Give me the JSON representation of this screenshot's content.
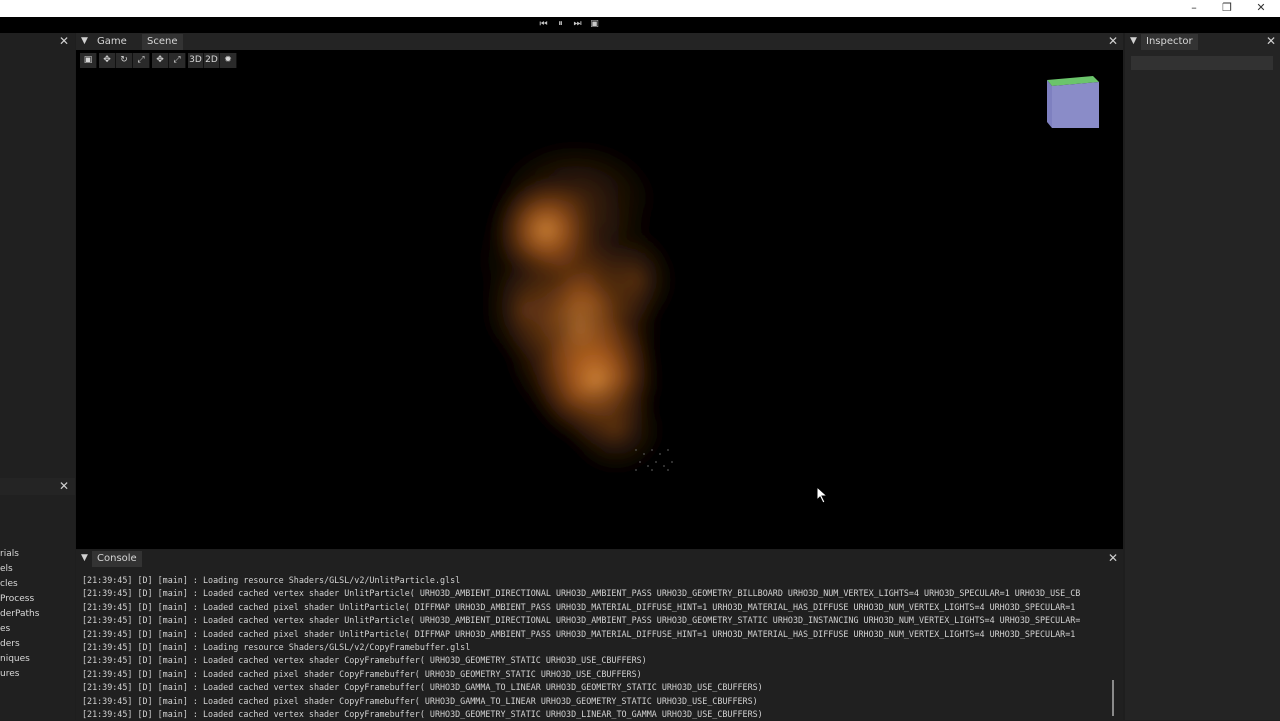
{
  "window": {
    "minimize_icon": "minimize-icon",
    "restore_icon": "restore-icon",
    "close_icon": "close-icon"
  },
  "transport": [
    "skip-back-icon",
    "pause-icon",
    "step-forward-icon",
    "save-icon"
  ],
  "hierarchy_panel": {
    "items": [
      "rials",
      "els",
      "cles",
      "Process",
      "derPaths",
      "es",
      "ders",
      "niques",
      "ures"
    ]
  },
  "viewport_panel": {
    "tabs": [
      {
        "label": "Game",
        "active": false
      },
      {
        "label": "Scene",
        "active": true
      }
    ],
    "toolbar": {
      "mode_3d": "3D",
      "mode_2d": "2D"
    }
  },
  "inspector_panel": {
    "title": "Inspector"
  },
  "console_panel": {
    "title": "Console",
    "lines": [
      "[21:39:45] [D] [main] : Loading resource Shaders/GLSL/v2/UnlitParticle.glsl",
      "[21:39:45] [D] [main] : Loaded cached vertex shader UnlitParticle( URHO3D_AMBIENT_DIRECTIONAL URHO3D_AMBIENT_PASS URHO3D_GEOMETRY_BILLBOARD URHO3D_NUM_VERTEX_LIGHTS=4 URHO3D_SPECULAR=1 URHO3D_USE_CB",
      "[21:39:45] [D] [main] : Loaded cached pixel shader UnlitParticle( DIFFMAP URHO3D_AMBIENT_PASS URHO3D_MATERIAL_DIFFUSE_HINT=1 URHO3D_MATERIAL_HAS_DIFFUSE URHO3D_NUM_VERTEX_LIGHTS=4 URHO3D_SPECULAR=1",
      "[21:39:45] [D] [main] : Loaded cached vertex shader UnlitParticle( URHO3D_AMBIENT_DIRECTIONAL URHO3D_AMBIENT_PASS URHO3D_GEOMETRY_STATIC URHO3D_INSTANCING URHO3D_NUM_VERTEX_LIGHTS=4 URHO3D_SPECULAR=",
      "[21:39:45] [D] [main] : Loaded cached pixel shader UnlitParticle( DIFFMAP URHO3D_AMBIENT_PASS URHO3D_MATERIAL_DIFFUSE_HINT=1 URHO3D_MATERIAL_HAS_DIFFUSE URHO3D_NUM_VERTEX_LIGHTS=4 URHO3D_SPECULAR=1",
      "[21:39:45] [D] [main] : Loading resource Shaders/GLSL/v2/CopyFramebuffer.glsl",
      "[21:39:45] [D] [main] : Loaded cached vertex shader CopyFramebuffer( URHO3D_GEOMETRY_STATIC URHO3D_USE_CBUFFERS)",
      "[21:39:45] [D] [main] : Loaded cached pixel shader CopyFramebuffer( URHO3D_GEOMETRY_STATIC URHO3D_USE_CBUFFERS)",
      "[21:39:45] [D] [main] : Loaded cached vertex shader CopyFramebuffer( URHO3D_GAMMA_TO_LINEAR URHO3D_GEOMETRY_STATIC URHO3D_USE_CBUFFERS)",
      "[21:39:45] [D] [main] : Loaded cached pixel shader CopyFramebuffer( URHO3D_GAMMA_TO_LINEAR URHO3D_GEOMETRY_STATIC URHO3D_USE_CBUFFERS)",
      "[21:39:45] [D] [main] : Loaded cached vertex shader CopyFramebuffer( URHO3D_GEOMETRY_STATIC URHO3D_LINEAR_TO_GAMMA URHO3D_USE_CBUFFERS)"
    ]
  },
  "colors": {
    "background": "#1e1e1e",
    "panel": "#242424",
    "viewport": "#000000",
    "fire": "#c8641e",
    "gizmo_cube": "#8a8cc8"
  }
}
